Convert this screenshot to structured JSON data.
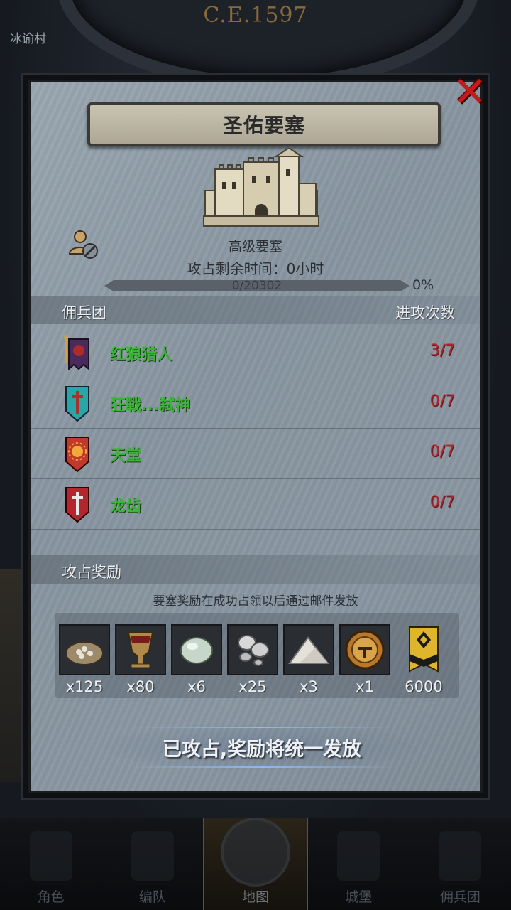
{
  "background": {
    "year": "C.E.1597",
    "village_label": "冰谕村"
  },
  "dialog": {
    "title": "圣佑要塞",
    "fortress_type": "高级要塞",
    "time_label": "攻占剩余时间：",
    "time_value": "0小时",
    "progress_text": "0/20302",
    "progress_fraction": 0,
    "progress_percent": "0%",
    "merc_header": "佣兵团",
    "attack_header": "进攻次数",
    "mercenaries": [
      {
        "name": "红狼猎人",
        "count": "3/7",
        "icon": "red-wolf-banner-icon"
      },
      {
        "name": "狂戰...弑神",
        "count": "0/7",
        "icon": "teal-sword-shield-icon"
      },
      {
        "name": "天堂",
        "count": "0/7",
        "icon": "sun-shield-icon"
      },
      {
        "name": "龙齿",
        "count": "0/7",
        "icon": "red-sword-shield-icon"
      }
    ],
    "reward_header": "攻占奖励",
    "reward_note": "要塞奖励在成功占领以后通过邮件发放",
    "rewards": [
      {
        "icon": "grain-sack-icon",
        "count": "x125"
      },
      {
        "icon": "goblet-icon",
        "count": "x80"
      },
      {
        "icon": "gem-stone-icon",
        "count": "x6"
      },
      {
        "icon": "silver-ore-icon",
        "count": "x25"
      },
      {
        "icon": "salt-pile-icon",
        "count": "x3"
      },
      {
        "icon": "knight-helmet-icon",
        "count": "x1"
      },
      {
        "icon": "honor-banner-icon",
        "count": "6000"
      }
    ],
    "status": "已攻占,奖励将统一发放"
  },
  "bottom_nav": [
    {
      "label": "角色",
      "icon": "character-icon"
    },
    {
      "label": "编队",
      "icon": "formation-icon"
    },
    {
      "label": "地图",
      "icon": "map-icon",
      "active": true
    },
    {
      "label": "城堡",
      "icon": "castle-nav-icon"
    },
    {
      "label": "佣兵团",
      "icon": "mercenary-icon"
    }
  ],
  "colors": {
    "merc_name": "#3cb53a",
    "attack_count": "#b3262e",
    "close": "#c81a1a"
  }
}
